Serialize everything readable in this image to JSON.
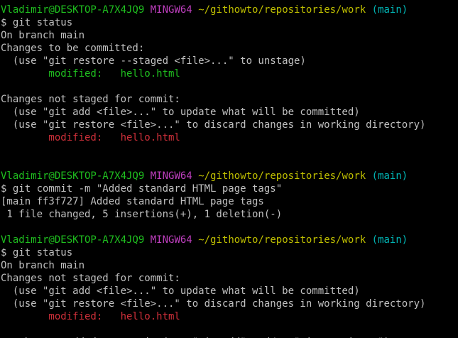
{
  "colors": {
    "background": "#000000",
    "text": "#c0c0c0",
    "user_host": "#1fbf1f",
    "mingw": "#bf3fbf",
    "path": "#bfbf00",
    "branch": "#00b4b4",
    "staged": "#1fbf1f",
    "unstaged": "#d0303a"
  },
  "lines": [
    {
      "segments": [
        {
          "text": "Vladimir@DESKTOP-A7X4JQ9",
          "role": "user"
        },
        {
          "text": " ",
          "role": "default"
        },
        {
          "text": "MINGW64",
          "role": "mingw"
        },
        {
          "text": " ",
          "role": "default"
        },
        {
          "text": "~/githowto/repositories/work",
          "role": "path"
        },
        {
          "text": " ",
          "role": "default"
        },
        {
          "text": "(main)",
          "role": "branch"
        }
      ]
    },
    {
      "segments": [
        {
          "text": "$ git status",
          "role": "default"
        }
      ]
    },
    {
      "segments": [
        {
          "text": "On branch main",
          "role": "default"
        }
      ]
    },
    {
      "segments": [
        {
          "text": "Changes to be committed:",
          "role": "default"
        }
      ]
    },
    {
      "segments": [
        {
          "text": "  (use \"git restore --staged <file>...\" to unstage)",
          "role": "default"
        }
      ]
    },
    {
      "segments": [
        {
          "text": "        modified:   hello.html",
          "role": "staged"
        }
      ]
    },
    {
      "segments": [
        {
          "text": "",
          "role": "default"
        }
      ]
    },
    {
      "segments": [
        {
          "text": "Changes not staged for commit:",
          "role": "default"
        }
      ]
    },
    {
      "segments": [
        {
          "text": "  (use \"git add <file>...\" to update what will be committed)",
          "role": "default"
        }
      ]
    },
    {
      "segments": [
        {
          "text": "  (use \"git restore <file>...\" to discard changes in working directory)",
          "role": "default"
        }
      ]
    },
    {
      "segments": [
        {
          "text": "        modified:   hello.html",
          "role": "unstaged"
        }
      ]
    },
    {
      "segments": [
        {
          "text": "",
          "role": "default"
        }
      ]
    },
    {
      "segments": [
        {
          "text": "",
          "role": "default"
        }
      ]
    },
    {
      "segments": [
        {
          "text": "Vladimir@DESKTOP-A7X4JQ9",
          "role": "user"
        },
        {
          "text": " ",
          "role": "default"
        },
        {
          "text": "MINGW64",
          "role": "mingw"
        },
        {
          "text": " ",
          "role": "default"
        },
        {
          "text": "~/githowto/repositories/work",
          "role": "path"
        },
        {
          "text": " ",
          "role": "default"
        },
        {
          "text": "(main)",
          "role": "branch"
        }
      ]
    },
    {
      "segments": [
        {
          "text": "$ git commit -m \"Added standard HTML page tags\"",
          "role": "default"
        }
      ]
    },
    {
      "segments": [
        {
          "text": "[main ff3f727] Added standard HTML page tags",
          "role": "default"
        }
      ]
    },
    {
      "segments": [
        {
          "text": " 1 file changed, 5 insertions(+), 1 deletion(-)",
          "role": "default"
        }
      ]
    },
    {
      "segments": [
        {
          "text": "",
          "role": "default"
        }
      ]
    },
    {
      "segments": [
        {
          "text": "Vladimir@DESKTOP-A7X4JQ9",
          "role": "user"
        },
        {
          "text": " ",
          "role": "default"
        },
        {
          "text": "MINGW64",
          "role": "mingw"
        },
        {
          "text": " ",
          "role": "default"
        },
        {
          "text": "~/githowto/repositories/work",
          "role": "path"
        },
        {
          "text": " ",
          "role": "default"
        },
        {
          "text": "(main)",
          "role": "branch"
        }
      ]
    },
    {
      "segments": [
        {
          "text": "$ git status",
          "role": "default"
        }
      ]
    },
    {
      "segments": [
        {
          "text": "On branch main",
          "role": "default"
        }
      ]
    },
    {
      "segments": [
        {
          "text": "Changes not staged for commit:",
          "role": "default"
        }
      ]
    },
    {
      "segments": [
        {
          "text": "  (use \"git add <file>...\" to update what will be committed)",
          "role": "default"
        }
      ]
    },
    {
      "segments": [
        {
          "text": "  (use \"git restore <file>...\" to discard changes in working directory)",
          "role": "default"
        }
      ]
    },
    {
      "segments": [
        {
          "text": "        modified:   hello.html",
          "role": "unstaged"
        }
      ]
    },
    {
      "segments": [
        {
          "text": "",
          "role": "default"
        }
      ]
    },
    {
      "segments": [
        {
          "text": "no changes added to commit (use \"git add\" and/or \"git commit -a\")",
          "role": "default"
        }
      ]
    }
  ]
}
